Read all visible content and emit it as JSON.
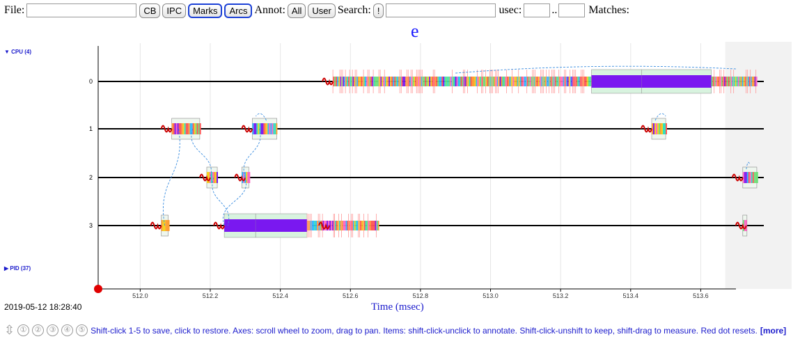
{
  "toolbar": {
    "file_label": "File:",
    "file_value": "",
    "btn_cb": "CB",
    "btn_ipc": "IPC",
    "btn_marks": "Marks",
    "btn_arcs": "Arcs",
    "annot_label": "Annot:",
    "btn_all": "All",
    "btn_user": "User",
    "search_label": "Search:",
    "btn_bang": "!",
    "search_value": "",
    "usec_label": "usec:",
    "usec_from": "",
    "range_sep": "..",
    "usec_to": "",
    "matches_label": "Matches:"
  },
  "title": "e",
  "cpu_header": "▼ CPU (4)",
  "pid_header": "▶ PID (37)",
  "timestamp": "2019-05-12 18:28:40",
  "footer": {
    "slots": [
      "①",
      "②",
      "③",
      "④",
      "⑤"
    ],
    "help": "Shift-click 1-5 to save, click to restore. Axes: scroll wheel to zoom, drag to pan. Items: shift-click-unclick to annotate. Shift-click-unshift to keep, shift-drag to measure. Red dot resets.",
    "more": "[more]"
  },
  "chart_data": {
    "type": "timeline",
    "xlabel": "Time (msec)",
    "ylabel": "",
    "xlim": [
      511.88,
      513.78
    ],
    "x_ticks": [
      512.0,
      512.2,
      512.4,
      512.6,
      512.8,
      513.0,
      513.2,
      513.4,
      513.6
    ],
    "x_tick_labels": [
      "512.0",
      "512.2",
      "512.4",
      "512.6",
      "512.8",
      "513.0",
      "513.2",
      "513.4",
      "513.6"
    ],
    "rows": [
      "0",
      "1",
      "2",
      "3"
    ],
    "grid": true,
    "shaded_region_start": 513.67,
    "activity": [
      {
        "row": "0",
        "start": 512.55,
        "end": 513.76
      },
      {
        "row": "1",
        "start": 512.09,
        "end": 512.17
      },
      {
        "row": "1",
        "start": 512.32,
        "end": 512.39
      },
      {
        "row": "1",
        "start": 513.46,
        "end": 513.5
      },
      {
        "row": "2",
        "start": 512.19,
        "end": 512.22
      },
      {
        "row": "2",
        "start": 512.29,
        "end": 512.31
      },
      {
        "row": "2",
        "start": 513.72,
        "end": 513.76
      },
      {
        "row": "3",
        "start": 512.06,
        "end": 512.08
      },
      {
        "row": "3",
        "start": 512.24,
        "end": 512.68
      },
      {
        "row": "3",
        "start": 513.72,
        "end": 513.73
      }
    ],
    "wakeups": [
      {
        "row": "0",
        "t": 512.54
      },
      {
        "row": "1",
        "t": 512.08
      },
      {
        "row": "1",
        "t": 512.31
      },
      {
        "row": "1",
        "t": 513.45
      },
      {
        "row": "2",
        "t": 512.19
      },
      {
        "row": "2",
        "t": 512.29
      },
      {
        "row": "2",
        "t": 513.71
      },
      {
        "row": "3",
        "t": 512.05
      },
      {
        "row": "3",
        "t": 512.23
      },
      {
        "row": "3",
        "t": 512.53
      },
      {
        "row": "3",
        "t": 513.72
      }
    ],
    "colors": {
      "rowline": "#000000",
      "grid": "#e6e6e6",
      "wakeup": "#cc0000",
      "arc": "#3a8de0",
      "idle": "#7a18f0",
      "box_fill": "#d8f3df",
      "shade": "#f2f2f2",
      "reset_dot": "#e00000"
    }
  }
}
